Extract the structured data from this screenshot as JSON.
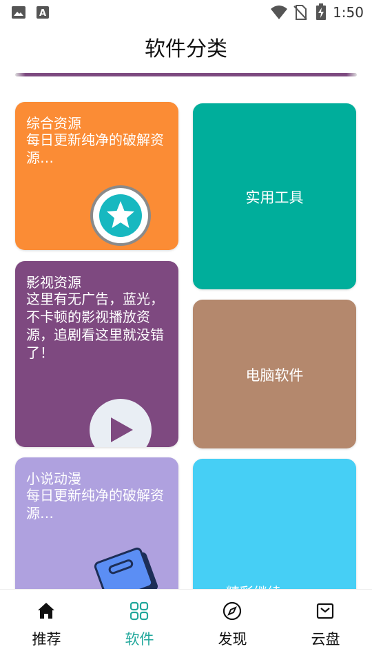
{
  "status_bar": {
    "time": "1:50"
  },
  "page": {
    "title": "软件分类"
  },
  "cards": {
    "comprehensive": {
      "title": "综合资源",
      "desc": "每日更新纯净的破解资源…",
      "color": "#fb8c35"
    },
    "tools": {
      "title": "实用工具",
      "color": "#00ae9b"
    },
    "video": {
      "title": "影视资源",
      "desc": "这里有无广告，蓝光，不卡顿的影视播放资源，追剧看这里就没错了！",
      "color": "#7e4980"
    },
    "pc": {
      "title": "电脑软件",
      "color": "#b4886d"
    },
    "novel": {
      "title": "小说动漫",
      "desc": "每日更新纯净的破解资源…",
      "color": "#afa1df"
    },
    "more": {
      "title": "精彩继续:",
      "color": "#46cff5"
    }
  },
  "icons": {
    "star": "star-badge-icon",
    "play": "play-circle-icon",
    "book": "book-icon"
  },
  "nav": [
    {
      "label": "推荐",
      "icon": "home-icon"
    },
    {
      "label": "软件",
      "icon": "grid-icon",
      "active": true,
      "active_color": "#20a79b"
    },
    {
      "label": "发现",
      "icon": "compass-icon"
    },
    {
      "label": "云盘",
      "icon": "inbox-icon"
    }
  ]
}
